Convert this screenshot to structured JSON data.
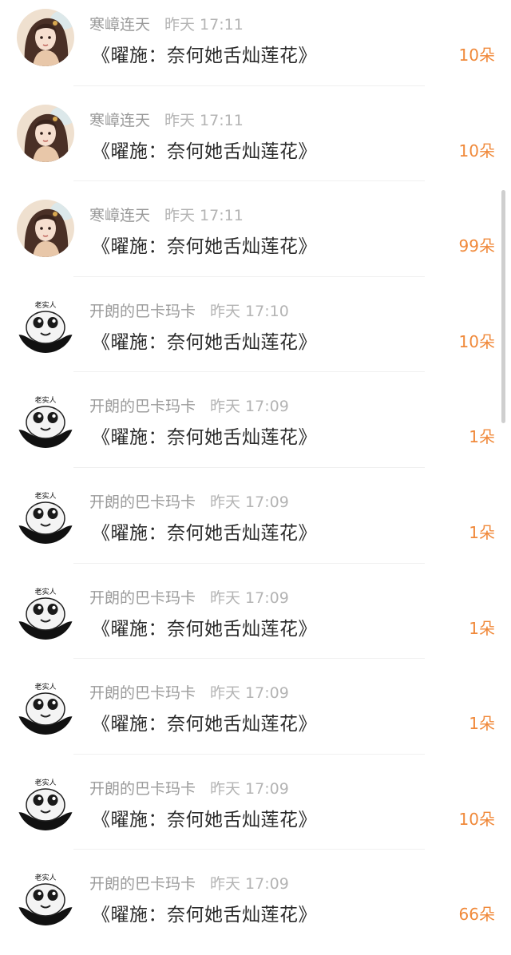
{
  "gift_list": {
    "items": [
      {
        "user": "寒嶂连天",
        "time": "昨天 17:11",
        "message": "《曜施：奈何她舌灿莲花》",
        "count": "10朵",
        "avatar": "girl-avatar-icon"
      },
      {
        "user": "寒嶂连天",
        "time": "昨天 17:11",
        "message": "《曜施：奈何她舌灿莲花》",
        "count": "10朵",
        "avatar": "girl-avatar-icon"
      },
      {
        "user": "寒嶂连天",
        "time": "昨天 17:11",
        "message": "《曜施：奈何她舌灿莲花》",
        "count": "99朵",
        "avatar": "girl-avatar-icon"
      },
      {
        "user": "开朗的巴卡玛卡",
        "time": "昨天 17:10",
        "message": "《曜施：奈何她舌灿莲花》",
        "count": "10朵",
        "avatar": "panda-avatar-icon",
        "avatar_caption": "老实人"
      },
      {
        "user": "开朗的巴卡玛卡",
        "time": "昨天 17:09",
        "message": "《曜施：奈何她舌灿莲花》",
        "count": "1朵",
        "avatar": "panda-avatar-icon",
        "avatar_caption": "老实人"
      },
      {
        "user": "开朗的巴卡玛卡",
        "time": "昨天 17:09",
        "message": "《曜施：奈何她舌灿莲花》",
        "count": "1朵",
        "avatar": "panda-avatar-icon",
        "avatar_caption": "老实人"
      },
      {
        "user": "开朗的巴卡玛卡",
        "time": "昨天 17:09",
        "message": "《曜施：奈何她舌灿莲花》",
        "count": "1朵",
        "avatar": "panda-avatar-icon",
        "avatar_caption": "老实人"
      },
      {
        "user": "开朗的巴卡玛卡",
        "time": "昨天 17:09",
        "message": "《曜施：奈何她舌灿莲花》",
        "count": "1朵",
        "avatar": "panda-avatar-icon",
        "avatar_caption": "老实人"
      },
      {
        "user": "开朗的巴卡玛卡",
        "time": "昨天 17:09",
        "message": "《曜施：奈何她舌灿莲花》",
        "count": "10朵",
        "avatar": "panda-avatar-icon",
        "avatar_caption": "老实人"
      },
      {
        "user": "开朗的巴卡玛卡",
        "time": "昨天 17:09",
        "message": "《曜施：奈何她舌灿莲花》",
        "count": "66朵",
        "avatar": "panda-avatar-icon",
        "avatar_caption": "老实人"
      }
    ]
  },
  "colors": {
    "count": "#f0893a",
    "username": "#9a9a9a",
    "message": "#2b2b2b"
  }
}
